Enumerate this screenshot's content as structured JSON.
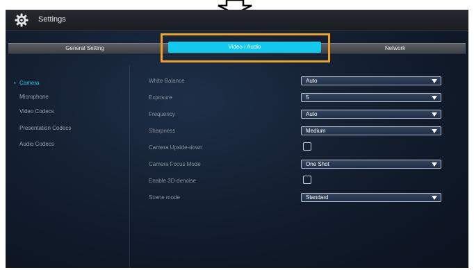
{
  "window": {
    "title": "Settings"
  },
  "tabs": [
    {
      "label": "General Setting",
      "active": false
    },
    {
      "label": "Video / Audio",
      "active": true
    },
    {
      "label": "Network",
      "active": false
    }
  ],
  "sidebar": {
    "items": [
      {
        "label": "Camera",
        "active": true
      },
      {
        "label": "Microphone",
        "active": false
      },
      {
        "label": "Video Codecs",
        "active": false
      },
      {
        "label": "Presentation Codecs",
        "active": false
      },
      {
        "label": "Audio Codecs",
        "active": false
      }
    ]
  },
  "settings": {
    "white_balance": {
      "label": "White Balance",
      "value": "Auto"
    },
    "exposure": {
      "label": "Exposure",
      "value": "5"
    },
    "frequency": {
      "label": "Frequency",
      "value": "Auto"
    },
    "sharpness": {
      "label": "Sharpness",
      "value": "Medium"
    },
    "upside_down": {
      "label": "Camera Upside-down",
      "checked": false
    },
    "focus_mode": {
      "label": "Camera Focus Mode",
      "value": "One Shot"
    },
    "denoise": {
      "label": "Enable 3D-denoise",
      "checked": false
    },
    "scene_mode": {
      "label": "Scene mode",
      "value": "Standard"
    }
  },
  "colors": {
    "accent": "#22c6ea",
    "active_tab": "#12c8ec",
    "highlight_border": "#f0a321",
    "background": "#121c2c"
  },
  "icons": [
    "gear-icon",
    "down-arrow-icon",
    "chevron-down-icon"
  ]
}
